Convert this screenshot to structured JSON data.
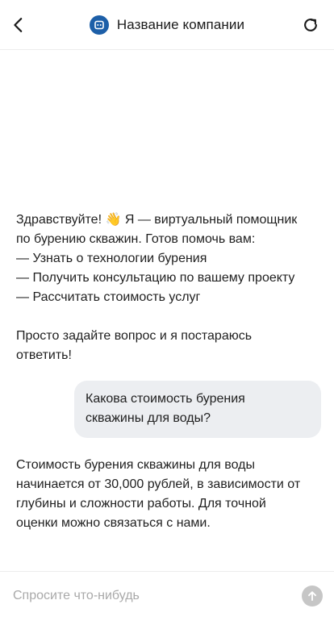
{
  "header": {
    "title": "Название компании",
    "back_icon": "chevron-left-icon",
    "refresh_icon": "refresh-icon",
    "logo_icon": "chat-bot-icon",
    "logo_color": "#1d5fa8"
  },
  "messages": {
    "bot_greeting": "Здравствуйте! 👋 Я — виртуальный помощник\nпо бурению скважин. Готов помочь вам:\n— Узнать о технологии бурения\n— Получить консультацию по вашему проекту\n— Рассчитать стоимость услуг\n\nПросто задайте вопрос и я постараюсь\nответить!",
    "user_question": "Какова стоимость бурения\nскважины для воды?",
    "bot_answer": "Стоимость бурения скважины для воды\nначинается от 30,000 рублей, в зависимости от\nглубины и сложности работы. Для точной\nоценки можно связаться с нами."
  },
  "composer": {
    "placeholder": "Спросите что-нибудь",
    "value": "",
    "send_icon": "arrow-up-icon"
  },
  "colors": {
    "user_bubble_bg": "#eceef1",
    "send_button_bg": "#c6c6c6",
    "divider": "#ececec"
  }
}
